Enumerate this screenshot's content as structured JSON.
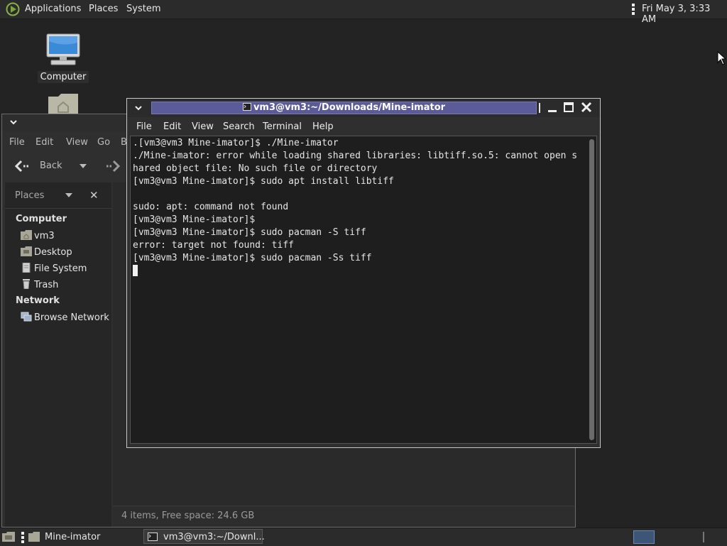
{
  "top_panel": {
    "apps_label": "Applications",
    "places_label": "Places",
    "system_label": "System",
    "clock": "Fri May 3, 3:33 AM"
  },
  "desktop": {
    "computer_label": "Computer"
  },
  "file_manager": {
    "menu": [
      "File",
      "Edit",
      "View",
      "Go",
      "B"
    ],
    "back_label": "Back",
    "places_label": "Places",
    "close_glyph": "✕",
    "sidebar": {
      "computer_header": "Computer",
      "computer_items": [
        "vm3",
        "Desktop",
        "File System",
        "Trash"
      ],
      "network_header": "Network",
      "network_items": [
        "Browse Network"
      ]
    },
    "status": "4 items, Free space: 24.6 GB"
  },
  "terminal": {
    "title": "vm3@vm3:~/Downloads/Mine-imator",
    "menu": [
      "File",
      "Edit",
      "View",
      "Search",
      "Terminal",
      "Help"
    ],
    "lines": [
      ".[vm3@vm3 Mine-imator]$ ./Mine-imator",
      "./Mine-imator: error while loading shared libraries: libtiff.so.5: cannot open s",
      "hared object file: No such file or directory",
      "[vm3@vm3 Mine-imator]$ sudo apt install libtiff",
      "",
      "sudo: apt: command not found",
      "[vm3@vm3 Mine-imator]$",
      "[vm3@vm3 Mine-imator]$ sudo pacman -S tiff",
      "error: target not found: tiff",
      "[vm3@vm3 Mine-imator]$ sudo pacman -Ss tiff"
    ]
  },
  "taskbar": {
    "files_task": "Mine-imator",
    "terminal_task": "vm3@vm3:~/Downl..."
  },
  "colors": {
    "title_active": "#5b5b99",
    "panel_bg": "#2b2b2b",
    "desktop_bg": "#232323",
    "workspace_active": "#3d5577"
  }
}
